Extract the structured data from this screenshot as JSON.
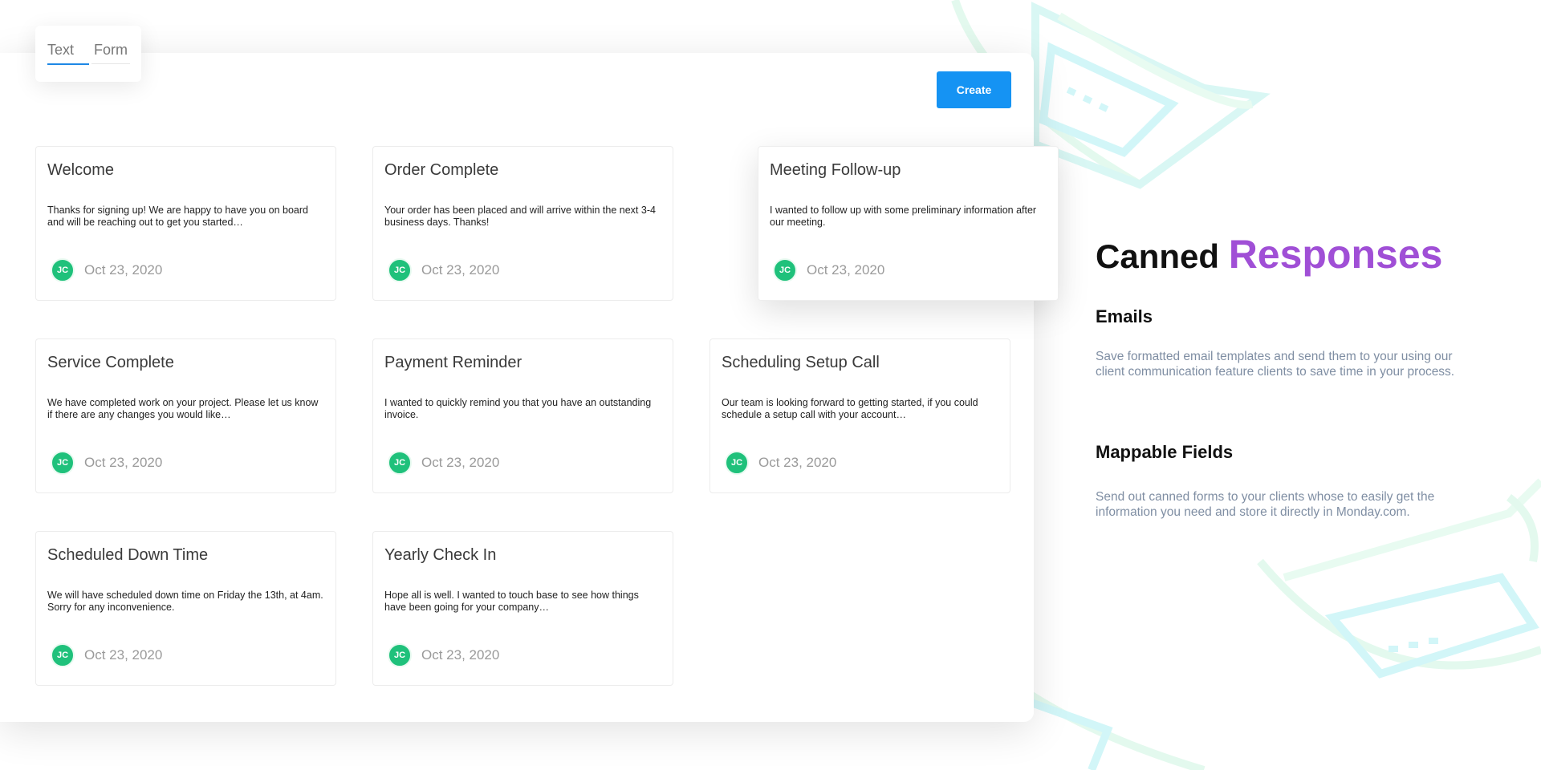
{
  "tabs": [
    {
      "label": "Text"
    },
    {
      "label": "Form"
    }
  ],
  "toolbar": {
    "create_label": "Create"
  },
  "cards": [
    {
      "title": "Welcome",
      "body": "Thanks for signing up! We are happy to have you on board and will be reaching out to get you started…",
      "avatar": "JC",
      "date": "Oct 23, 2020"
    },
    {
      "title": "Order Complete",
      "body": "Your order has been placed and will arrive within the next 3-4 business days. Thanks!",
      "avatar": "JC",
      "date": "Oct 23, 2020"
    },
    {
      "title": "Meeting Follow-up",
      "body": "I wanted to follow up with some preliminary information after our meeting.",
      "avatar": "JC",
      "date": "Oct 23, 2020"
    },
    {
      "title": "Service Complete",
      "body": "We have completed work on your project. Please let us know if there are any changes you would like…",
      "avatar": "JC",
      "date": "Oct 23, 2020"
    },
    {
      "title": "Payment Reminder",
      "body": "I wanted to quickly remind you that you have an outstanding invoice.",
      "avatar": "JC",
      "date": "Oct 23, 2020"
    },
    {
      "title": "Scheduling Setup Call",
      "body": "Our team is looking forward to getting started, if you could schedule a setup call with your account…",
      "avatar": "JC",
      "date": "Oct 23, 2020"
    },
    {
      "title": "Scheduled Down Time",
      "body": "We will have scheduled down time on Friday the 13th, at 4am. Sorry for any inconvenience.",
      "avatar": "JC",
      "date": "Oct 23, 2020"
    },
    {
      "title": "Yearly Check In",
      "body": "Hope all is well. I wanted to touch base to see how things have been going for your company…",
      "avatar": "JC",
      "date": "Oct 23, 2020"
    }
  ],
  "info": {
    "title_plain": "Canned",
    "title_accent": "Responses",
    "sections": [
      {
        "heading": "Emails",
        "text": "Save formatted email templates and send them to your using our client communication feature clients to save time in your process."
      },
      {
        "heading": "Mappable Fields",
        "text": "Send out canned forms to your clients whose to easily get the information you need and store it directly in Monday.com."
      }
    ]
  },
  "colors": {
    "accent": "#a04fd6",
    "primary_button": "#1593f3",
    "avatar": "#1fc17b",
    "tab_underline": "#1e88e5"
  }
}
